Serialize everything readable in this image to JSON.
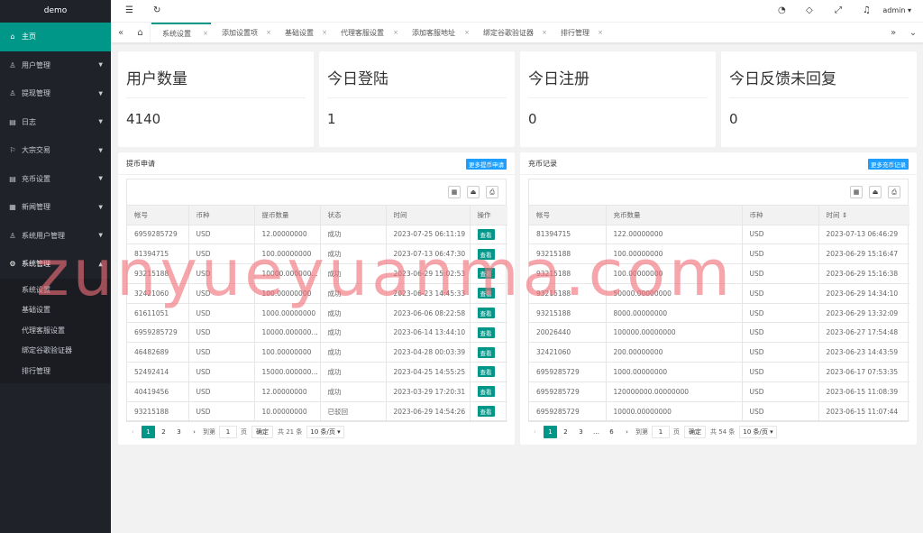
{
  "app": {
    "title": "demo",
    "user": "admin"
  },
  "sidebar": {
    "items": [
      {
        "label": "主页",
        "icon": "home-icon"
      },
      {
        "label": "用户管理",
        "icon": "user-icon"
      },
      {
        "label": "提现管理",
        "icon": "user-icon"
      },
      {
        "label": "日志",
        "icon": "list-icon"
      },
      {
        "label": "大宗交易",
        "icon": "trade-icon"
      },
      {
        "label": "充币设置",
        "icon": "list-icon"
      },
      {
        "label": "新闻管理",
        "icon": "news-icon"
      },
      {
        "label": "系统用户管理",
        "icon": "user-icon"
      },
      {
        "label": "系统管理",
        "icon": "gear-icon"
      }
    ],
    "sub_items": [
      "系统设置",
      "基础设置",
      "代理客服设置",
      "绑定谷歌验证器",
      "排行管理"
    ]
  },
  "tabs": [
    "系统设置",
    "添加设置项",
    "基础设置",
    "代理客服设置",
    "添加客服地址",
    "绑定谷歌验证器",
    "排行管理"
  ],
  "stats": [
    {
      "title": "用户数量",
      "value": "4140"
    },
    {
      "title": "今日登陆",
      "value": "1"
    },
    {
      "title": "今日注册",
      "value": "0"
    },
    {
      "title": "今日反馈未回复",
      "value": "0"
    }
  ],
  "withdraw": {
    "title": "提币申请",
    "more_button": "更多提币申请",
    "columns": [
      "帐号",
      "币种",
      "提币数量",
      "状态",
      "时间",
      "操作"
    ],
    "action_label": "查看",
    "rows": [
      [
        "6959285729",
        "USD",
        "12.00000000",
        "成功",
        "2023-07-25 06:11:19"
      ],
      [
        "81394715",
        "USD",
        "100.00000000",
        "成功",
        "2023-07-13 06:47:30"
      ],
      [
        "93215188",
        "USD",
        "10000.00000000",
        "成功",
        "2023-06-29 15:02:53"
      ],
      [
        "32421060",
        "USD",
        "100.00000000",
        "成功",
        "2023-06-23 14:45:33"
      ],
      [
        "61611051",
        "USD",
        "1000.00000000",
        "成功",
        "2023-06-06 08:22:58"
      ],
      [
        "6959285729",
        "USD",
        "10000.00000000",
        "成功",
        "2023-06-14 13:44:10"
      ],
      [
        "46482689",
        "USD",
        "100.00000000",
        "成功",
        "2023-04-28 00:03:39"
      ],
      [
        "52492414",
        "USD",
        "15000.00000000",
        "成功",
        "2023-04-25 14:55:25"
      ],
      [
        "40419456",
        "USD",
        "12.00000000",
        "成功",
        "2023-03-29 17:20:31"
      ],
      [
        "93215188",
        "USD",
        "10.00000000",
        "已驳回",
        "2023-06-29 14:54:26"
      ]
    ],
    "pager": {
      "pages": [
        "1",
        "2",
        "3"
      ],
      "goto_label": "到第",
      "goto_value": "1",
      "page_unit": "页",
      "confirm": "确定",
      "total": "共 21 条",
      "per_page": "10 条/页"
    }
  },
  "recharge": {
    "title": "充币记录",
    "more_button": "更多充币记录",
    "columns": [
      "帐号",
      "充币数量",
      "币种",
      "时间"
    ],
    "rows": [
      [
        "81394715",
        "122.00000000",
        "USD",
        "2023-07-13 06:46:29"
      ],
      [
        "93215188",
        "100.00000000",
        "USD",
        "2023-06-29 15:16:47"
      ],
      [
        "93215188",
        "100.00000000",
        "USD",
        "2023-06-29 15:16:38"
      ],
      [
        "93215188",
        "50000.00000000",
        "USD",
        "2023-06-29 14:34:10"
      ],
      [
        "93215188",
        "8000.00000000",
        "USD",
        "2023-06-29 13:32:09"
      ],
      [
        "20026440",
        "100000.00000000",
        "USD",
        "2023-06-27 17:54:48"
      ],
      [
        "32421060",
        "200.00000000",
        "USD",
        "2023-06-23 14:43:59"
      ],
      [
        "6959285729",
        "1000.00000000",
        "USD",
        "2023-06-17 07:53:35"
      ],
      [
        "6959285729",
        "120000000.00000000",
        "USD",
        "2023-06-15 11:08:39"
      ],
      [
        "6959285729",
        "10000.00000000",
        "USD",
        "2023-06-15 11:07:44"
      ]
    ],
    "pager": {
      "pages": [
        "1",
        "2",
        "3",
        "…",
        "6"
      ],
      "goto_label": "到第",
      "goto_value": "1",
      "page_unit": "页",
      "confirm": "确定",
      "total": "共 54 条",
      "per_page": "10 条/页"
    }
  },
  "watermark": "zunyueyuanma.com",
  "colors": {
    "sidebar": "#20222a",
    "accent": "#009688",
    "link_button": "#1e9fff"
  }
}
